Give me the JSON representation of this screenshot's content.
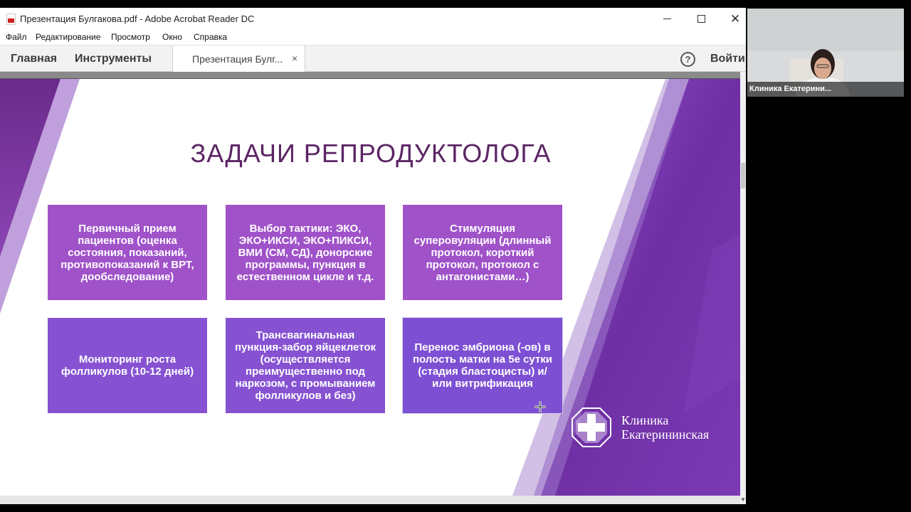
{
  "window": {
    "title": "Презентация Булгакова.pdf - Adobe Acrobat Reader DC",
    "close_glyph": "✕"
  },
  "menu": {
    "items": [
      {
        "label": "Файл"
      },
      {
        "label": "Редактирование"
      },
      {
        "label": "Просмотр"
      },
      {
        "label": "Окно"
      },
      {
        "label": "Справка"
      }
    ]
  },
  "toolbar": {
    "home": "Главная",
    "tools": "Инструменты",
    "tab_label": "Презентация Булг...",
    "tab_close": "×",
    "help": "?",
    "login": "Войти"
  },
  "slide": {
    "title": "ЗАДАЧИ РЕПРОДУКТОЛОГА",
    "tasks": [
      "Первичный прием пациентов (оценка состояния, показаний, противопоказаний к ВРТ, дообследование)",
      "Выбор тактики: ЭКО, ЭКО+ИКСИ, ЭКО+ПИКСИ, ВМИ (СМ, СД), донорские программы, пункция в естественном цикле и т.д.",
      "Стимуляция суперовуляции (длинный протокол, короткий протокол, протокол с антагонистами…)",
      "Мониторинг роста фолликулов (10-12 дней)",
      "Трансвагинальная пункция-забор яйцеклеток (осуществляется преимущественно под наркозом, с промыванием фолликулов и без)",
      "Перенос эмбриона (-ов) в полость матки на 5е сутки (стадия бластоцисты) и/или витрификация"
    ],
    "logo_line1": "Клиника",
    "logo_line2": "Екатерининская",
    "colors": {
      "title": "#5c2565",
      "box_row1": "#a052c9",
      "box_row2": "#8652d2",
      "band_dark": "#6f2fa4"
    }
  },
  "video": {
    "participant_label": "Клиника Екатерини..."
  }
}
